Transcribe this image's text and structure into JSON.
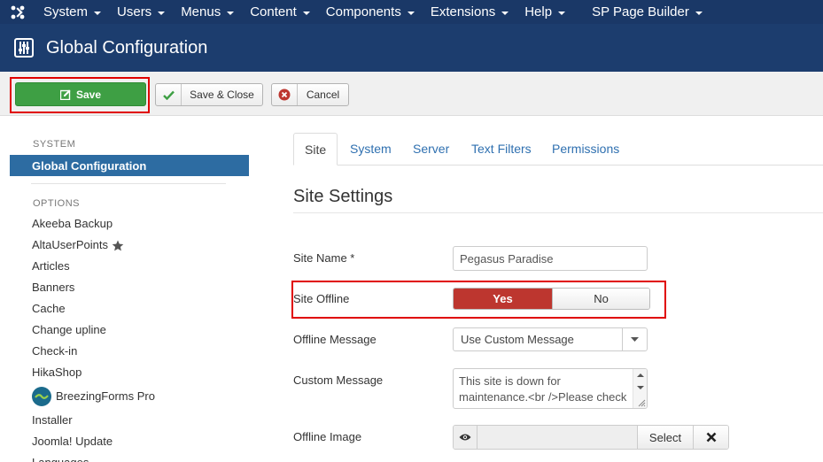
{
  "nav": {
    "items": [
      {
        "label": "System"
      },
      {
        "label": "Users"
      },
      {
        "label": "Menus"
      },
      {
        "label": "Content"
      },
      {
        "label": "Components"
      },
      {
        "label": "Extensions"
      },
      {
        "label": "Help"
      },
      {
        "label": "SP Page Builder"
      }
    ]
  },
  "header": {
    "title": "Global Configuration"
  },
  "toolbar": {
    "save_label": "Save",
    "save_close_label": "Save & Close",
    "cancel_label": "Cancel"
  },
  "sidebar": {
    "system_heading": "SYSTEM",
    "active_item": "Global Configuration",
    "options_heading": "OPTIONS",
    "items": [
      {
        "label": "Akeeba Backup"
      },
      {
        "label": "AltaUserPoints"
      },
      {
        "label": "Articles"
      },
      {
        "label": "Banners"
      },
      {
        "label": "Cache"
      },
      {
        "label": "Change upline"
      },
      {
        "label": "Check-in"
      },
      {
        "label": "HikaShop"
      },
      {
        "label": "BreezingForms Pro"
      },
      {
        "label": "Installer"
      },
      {
        "label": "Joomla! Update"
      },
      {
        "label": "Languages"
      }
    ]
  },
  "tabs": [
    {
      "label": "Site"
    },
    {
      "label": "System"
    },
    {
      "label": "Server"
    },
    {
      "label": "Text Filters"
    },
    {
      "label": "Permissions"
    }
  ],
  "main": {
    "section_title": "Site Settings",
    "site_name_label": "Site Name *",
    "site_name_value": "Pegasus Paradise",
    "site_offline_label": "Site Offline",
    "toggle_yes": "Yes",
    "toggle_no": "No",
    "offline_message_label": "Offline Message",
    "offline_message_value": "Use Custom Message",
    "custom_message_label": "Custom Message",
    "custom_message_value": "This site is down for maintenance.<br />Please check back again soon.",
    "offline_image_label": "Offline Image",
    "select_label": "Select"
  },
  "colors": {
    "nav_bg": "#1a3867",
    "header_bg": "#1c3d6e",
    "save_green": "#3e9f44",
    "active_blue": "#2d6ca2",
    "yes_red": "#bd362f",
    "highlight_red": "#e00000"
  }
}
